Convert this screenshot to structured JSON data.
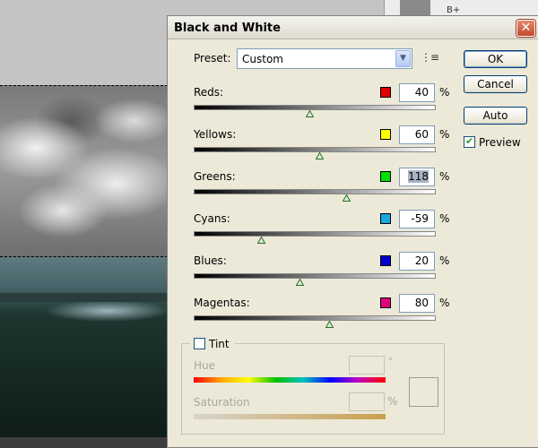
{
  "dialog": {
    "title": "Black and White",
    "close_glyph": "✕",
    "preset_label": "Preset:",
    "preset_value": "Custom",
    "preset_arrow": "▼",
    "preset_options_glyph": "⋮≡",
    "buttons": {
      "ok": "OK",
      "cancel": "Cancel",
      "auto": "Auto"
    },
    "preview_label": "Preview",
    "preview_checked": true
  },
  "sliders": [
    {
      "label": "Reds:",
      "value": "40",
      "color": "#e00000",
      "fraction": 0.48
    },
    {
      "label": "Yellows:",
      "value": "60",
      "color": "#ffff00",
      "fraction": 0.52
    },
    {
      "label": "Greens:",
      "value": "118",
      "color": "#00e000",
      "fraction": 0.63
    },
    {
      "label": "Cyans:",
      "value": "-59",
      "color": "#1aa8e0",
      "fraction": 0.28
    },
    {
      "label": "Blues:",
      "value": "20",
      "color": "#0000d0",
      "fraction": 0.44
    },
    {
      "label": "Magentas:",
      "value": "80",
      "color": "#e0007a",
      "fraction": 0.56
    }
  ],
  "percent_sign": "%",
  "tint": {
    "label": "Tint",
    "checked": false,
    "hue_label": "Hue",
    "hue_unit": "°",
    "saturation_label": "Saturation",
    "saturation_unit": "%"
  },
  "background": {
    "panel_text": "B+"
  }
}
